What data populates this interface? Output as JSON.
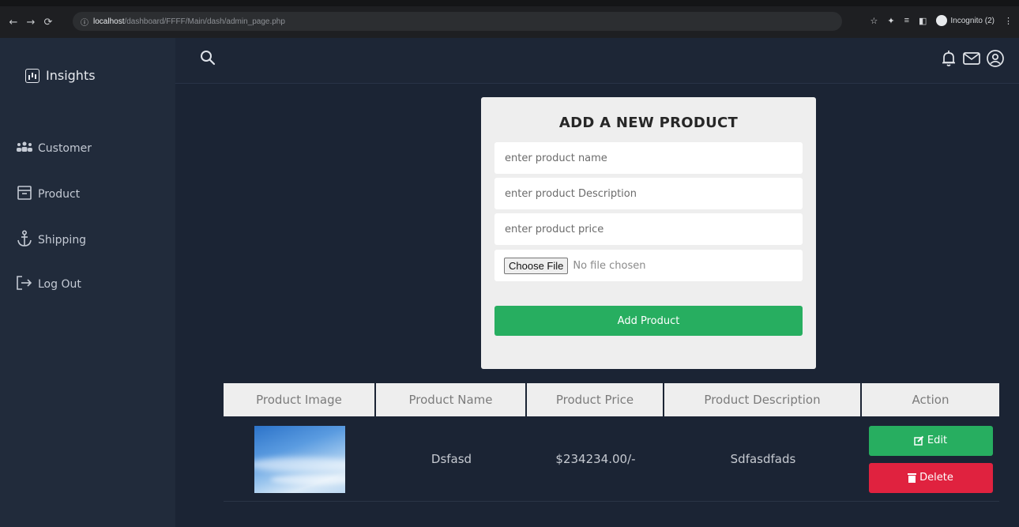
{
  "browser": {
    "url_host": "localhost",
    "url_path": "/dashboard/FFFF/Main/dash/admin_page.php",
    "profile_label": "Incognito (2)"
  },
  "sidebar": {
    "brand": "Insights",
    "items": [
      {
        "label": "Customer",
        "icon": "users-icon"
      },
      {
        "label": "Product",
        "icon": "archive-icon"
      },
      {
        "label": "Shipping",
        "icon": "anchor-icon"
      },
      {
        "label": "Log Out",
        "icon": "logout-icon"
      }
    ]
  },
  "form": {
    "title": "ADD A NEW PRODUCT",
    "name_placeholder": "enter product name",
    "description_placeholder": "enter product Description",
    "price_placeholder": "enter product price",
    "file_button": "Choose File",
    "file_status": "No file chosen",
    "submit_label": "Add Product"
  },
  "table": {
    "headers": [
      "Product Image",
      "Product Name",
      "Product Price",
      "Product Description",
      "Action"
    ],
    "rows": [
      {
        "name": "Dsfasd",
        "price": "$234234.00/-",
        "description": "Sdfasdfads",
        "edit_label": "Edit",
        "delete_label": "Delete"
      }
    ]
  },
  "colors": {
    "accent_green": "#27ae60",
    "danger_red": "#e0223f",
    "sidebar_bg": "#212b3b",
    "main_bg": "#1b2434"
  }
}
